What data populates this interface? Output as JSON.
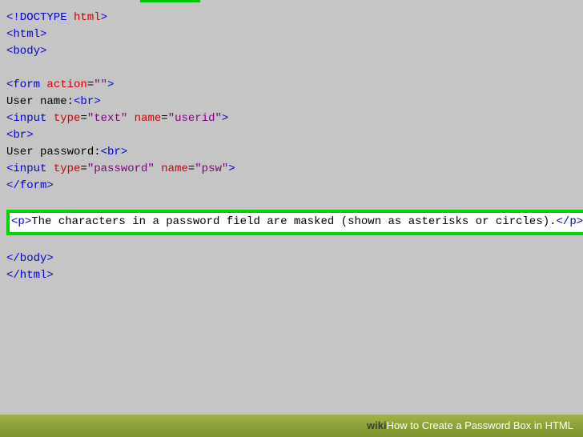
{
  "code": {
    "l1a": "<!DOCTYPE",
    "l1b": " html",
    "l1c": ">",
    "l2a": "<html>",
    "l3a": "<body>",
    "l5a": "<form",
    "l5b": " action",
    "l5c": "=",
    "l5d": "\"\"",
    "l5e": ">",
    "l6a": "User name:",
    "l6b": "<br>",
    "l7a": "<input",
    "l7b": " type",
    "l7c": "=",
    "l7d": "\"text\"",
    "l7e": " name",
    "l7f": "=",
    "l7g": "\"userid\"",
    "l7h": ">",
    "l8a": "<br>",
    "l9a": "User password:",
    "l9b": "<br>",
    "l10a": "<input",
    "l10b": " type",
    "l10c": "=",
    "l10d": "\"password\"",
    "l10e": " name",
    "l10f": "=",
    "l10g": "\"psw\"",
    "l10h": ">",
    "l11a": "</form>",
    "l13a": "<p>",
    "l13b": "The characters in a password field are masked (shown as asterisks or circles).",
    "l13c": "</p>",
    "l15a": "</body>",
    "l16a": "</html>"
  },
  "footer": {
    "brand_prefix": "wiki",
    "brand_suffix": "How to Create a Password Box in HTML"
  }
}
